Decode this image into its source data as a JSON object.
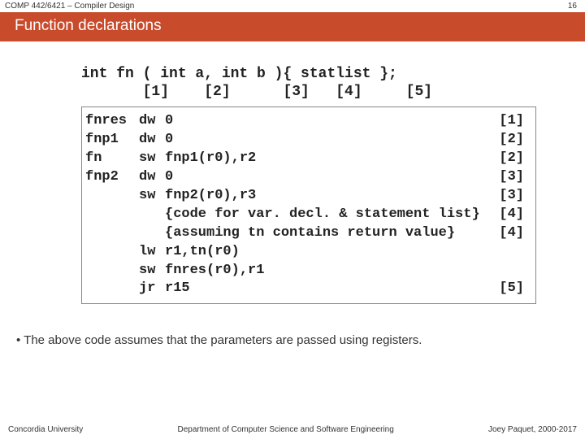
{
  "header": {
    "course": "COMP 442/6421 – Compiler Design",
    "page_no": "16",
    "title": "Function declarations"
  },
  "decl": {
    "signature": "int fn ( int a, int b ){ statlist };",
    "markers": "       [1]    [2]      [3]   [4]     [5]"
  },
  "code": [
    {
      "label": "fnres",
      "op": "dw",
      "arg": "0",
      "tag": "[1]"
    },
    {
      "label": "fnp1",
      "op": "dw",
      "arg": "0",
      "tag": "[2]"
    },
    {
      "label": "fn",
      "op": "sw",
      "arg": "fnp1(r0),r2",
      "tag": "[2]"
    },
    {
      "label": "fnp2",
      "op": "dw",
      "arg": "0",
      "tag": "[3]"
    },
    {
      "label": "",
      "op": "sw",
      "arg": "fnp2(r0),r3",
      "tag": "[3]"
    },
    {
      "label": "",
      "op": "",
      "arg": "{code for var. decl. & statement list}",
      "tag": "[4]"
    },
    {
      "label": "",
      "op": "",
      "arg": "{assuming tn contains return value}",
      "tag": "[4]"
    },
    {
      "label": "",
      "op": "lw",
      "arg": "r1,tn(r0)",
      "tag": ""
    },
    {
      "label": "",
      "op": "sw",
      "arg": "fnres(r0),r1",
      "tag": ""
    },
    {
      "label": "",
      "op": "jr",
      "arg": "r15",
      "tag": "[5]"
    }
  ],
  "note": "The above code assumes that the parameters are passed using registers.",
  "footer": {
    "left": "Concordia University",
    "center": "Department of Computer Science and Software Engineering",
    "right": "Joey Paquet, 2000-2017"
  }
}
